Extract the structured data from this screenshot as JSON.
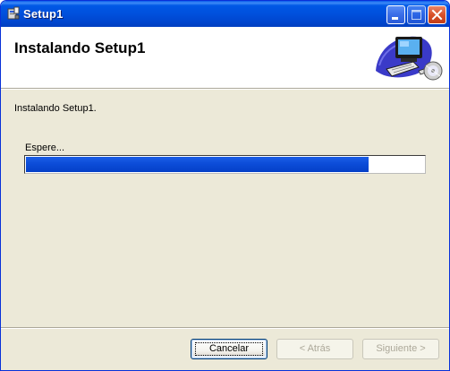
{
  "window": {
    "title": "Setup1",
    "title_icon": "installer-icon"
  },
  "title_buttons": {
    "minimize_icon": "minimize-icon",
    "maximize_icon": "maximize-icon",
    "close_icon": "close-icon"
  },
  "header": {
    "title": "Instalando Setup1",
    "image": "computer-with-cd-icon"
  },
  "main": {
    "status": "Instalando Setup1.",
    "wait_label": "Espere...",
    "progress_fraction": 0.86
  },
  "footer": {
    "cancel_label": "Cancelar",
    "back_label": "< Atrás",
    "next_label": "Siguiente >",
    "back_enabled": false,
    "next_enabled": false
  },
  "colors": {
    "titlebar": "#0054E3",
    "progress": "#0B4BD7",
    "dialog_bg": "#ECE9D8"
  }
}
